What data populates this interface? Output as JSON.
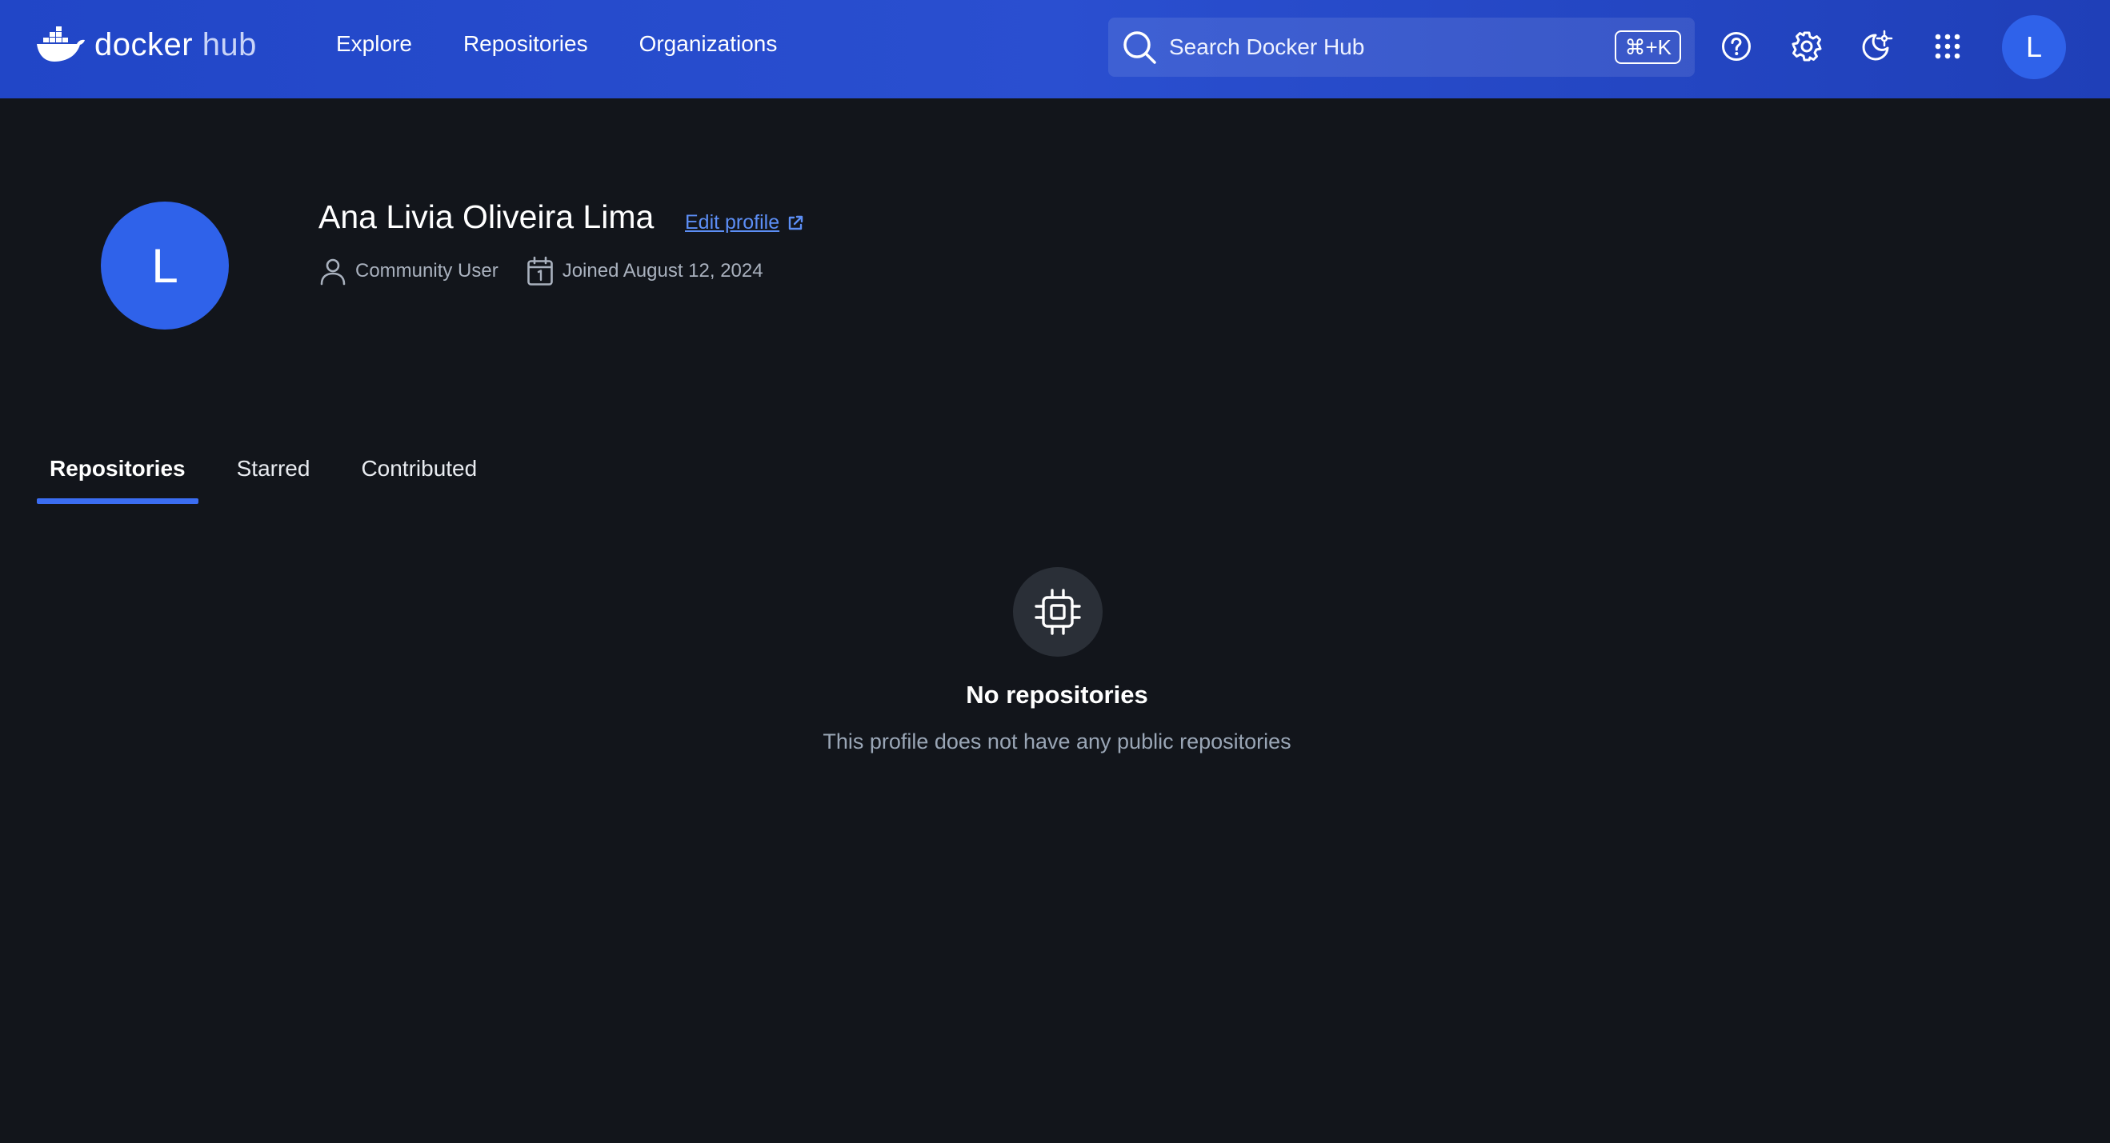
{
  "header": {
    "brand_primary": "docker",
    "brand_secondary": "hub",
    "nav": [
      {
        "label": "Explore"
      },
      {
        "label": "Repositories"
      },
      {
        "label": "Organizations"
      }
    ],
    "search": {
      "placeholder": "Search Docker Hub",
      "shortcut": "⌘+K"
    },
    "icons": [
      "help-icon",
      "gear-icon",
      "theme-toggle-icon",
      "apps-grid-icon"
    ],
    "avatar_initial": "L"
  },
  "profile": {
    "avatar_initial": "L",
    "name": "Ana Livia Oliveira Lima",
    "edit_label": "Edit profile",
    "role": "Community User",
    "joined": "Joined August 12, 2024"
  },
  "tabs": [
    {
      "label": "Repositories",
      "active": true
    },
    {
      "label": "Starred",
      "active": false
    },
    {
      "label": "Contributed",
      "active": false
    }
  ],
  "empty_state": {
    "icon": "chip-icon",
    "title": "No repositories",
    "subtitle": "This profile does not have any public repositories"
  },
  "colors": {
    "header_blue": "#2146c7",
    "background": "#12151b",
    "accent": "#3b6df2",
    "link": "#5c8ef5"
  }
}
